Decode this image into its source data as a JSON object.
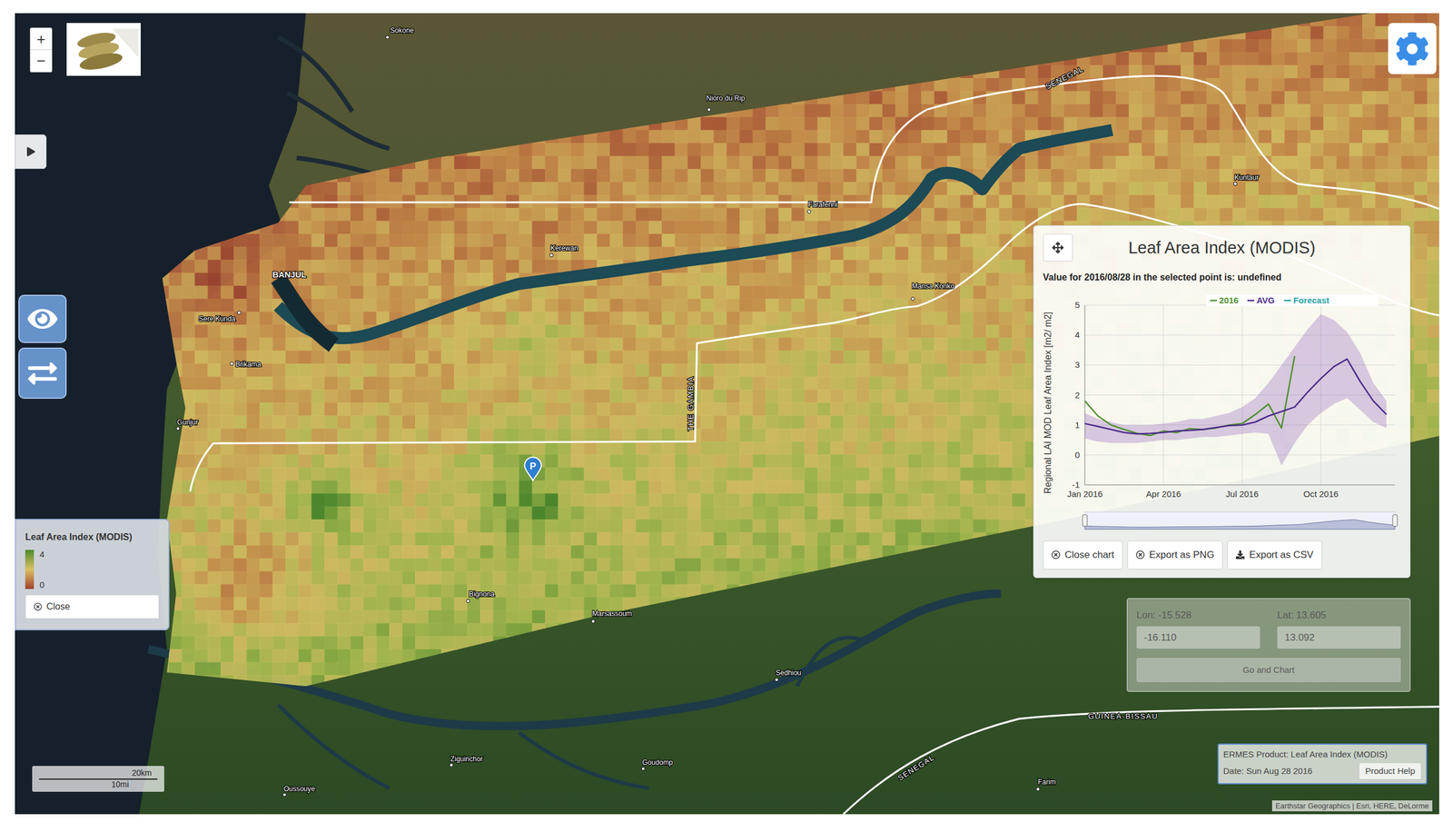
{
  "map": {
    "places": [
      {
        "name": "Sokone",
        "kind": "town"
      },
      {
        "name": "Nioro du Rip",
        "kind": "town"
      },
      {
        "name": "SENEGAL",
        "kind": "country"
      },
      {
        "name": "Farafenni",
        "kind": "town"
      },
      {
        "name": "Kuntaur",
        "kind": "town"
      },
      {
        "name": "Kerewan",
        "kind": "town"
      },
      {
        "name": "BANJUL",
        "kind": "capital"
      },
      {
        "name": "Sere Kunda",
        "kind": "town"
      },
      {
        "name": "Brikama",
        "kind": "town"
      },
      {
        "name": "Gunjur",
        "kind": "town"
      },
      {
        "name": "Mansa Konko",
        "kind": "town"
      },
      {
        "name": "THE GAMBIA",
        "kind": "country"
      },
      {
        "name": "Bignona",
        "kind": "town"
      },
      {
        "name": "Marsassoum",
        "kind": "town"
      },
      {
        "name": "Sedhiou",
        "kind": "town"
      },
      {
        "name": "Ziguinchor",
        "kind": "town"
      },
      {
        "name": "Goudomp",
        "kind": "town"
      },
      {
        "name": "Oussouye",
        "kind": "town"
      },
      {
        "name": "Farim",
        "kind": "town"
      },
      {
        "name": "GUINEA-BISSAU",
        "kind": "country"
      },
      {
        "name": "SENEGAL",
        "kind": "country"
      }
    ],
    "pin": {
      "label": "P"
    },
    "scale_bar": {
      "metric": "20km",
      "imperial": "10mi"
    },
    "attribution": "Earthstar Geographics | Esri, HERE, DeLorme"
  },
  "zoom": {
    "in": "+",
    "out": "−"
  },
  "legend": {
    "title": "Leaf Area Index (MODIS)",
    "max": "4",
    "min": "0",
    "close": "Close"
  },
  "chart": {
    "title": "Leaf Area Index (MODIS)",
    "subtitle": "Value for 2016/08/28 in the selected point is: undefined",
    "y_axis": {
      "label": "Regional LAI MOD Leaf Area Index [m2/ m2]",
      "ticks": [
        "5",
        "4",
        "3",
        "2",
        "1",
        "0",
        "-1"
      ]
    },
    "x_axis": {
      "ticks": [
        "Jan 2016",
        "Apr 2016",
        "Jul 2016",
        "Oct 2016"
      ]
    },
    "series": [
      {
        "name": "2016",
        "color": "#4f8f2f",
        "values": [
          1.8,
          1.3,
          1.0,
          0.85,
          0.72,
          0.65,
          0.8,
          0.75,
          0.88,
          0.85,
          0.9,
          1.0,
          1.05,
          1.35,
          1.7,
          0.9,
          3.3
        ]
      },
      {
        "name": "AVG",
        "color": "#4b2a8c",
        "values": [
          1.05,
          0.95,
          0.85,
          0.75,
          0.7,
          0.72,
          0.75,
          0.8,
          0.82,
          0.85,
          0.92,
          0.98,
          1.0,
          1.1,
          1.3,
          1.45,
          1.6,
          2.1,
          2.55,
          2.95,
          3.2,
          2.45,
          1.8,
          1.35
        ]
      },
      {
        "name": "Forecast",
        "color": "#2a9fa6",
        "values": []
      }
    ],
    "avg_range": {
      "upper": [
        1.4,
        1.2,
        1.1,
        1.0,
        1.0,
        1.0,
        1.05,
        1.1,
        1.2,
        1.2,
        1.3,
        1.4,
        1.6,
        1.9,
        2.4,
        3.0,
        3.6,
        4.2,
        4.7,
        4.5,
        4.1,
        3.4,
        2.4,
        1.8
      ],
      "lower": [
        0.55,
        0.45,
        0.4,
        0.4,
        0.4,
        0.45,
        0.5,
        0.5,
        0.55,
        0.6,
        0.6,
        0.65,
        0.7,
        0.75,
        0.7,
        -0.35,
        0.4,
        1.0,
        1.4,
        1.7,
        1.9,
        1.5,
        1.1,
        0.9
      ]
    },
    "navigator": {
      "start": 0,
      "end": 1
    },
    "buttons": [
      {
        "label": "Close chart",
        "kind": "close"
      },
      {
        "label": "Export as PNG",
        "kind": "close"
      },
      {
        "label": "Export as CSV",
        "kind": "download"
      }
    ]
  },
  "coordinates": {
    "lon_label": "Lon: -15.528",
    "lat_label": "Lat: 13.605",
    "lon_value": "-16.110",
    "lat_value": "13.092",
    "button": "Go and Chart"
  },
  "product_info": {
    "product": "ERMES Product: Leaf Area Index (MODIS)",
    "date": "Date: Sun Aug 28 2016",
    "help": "Product Help"
  }
}
